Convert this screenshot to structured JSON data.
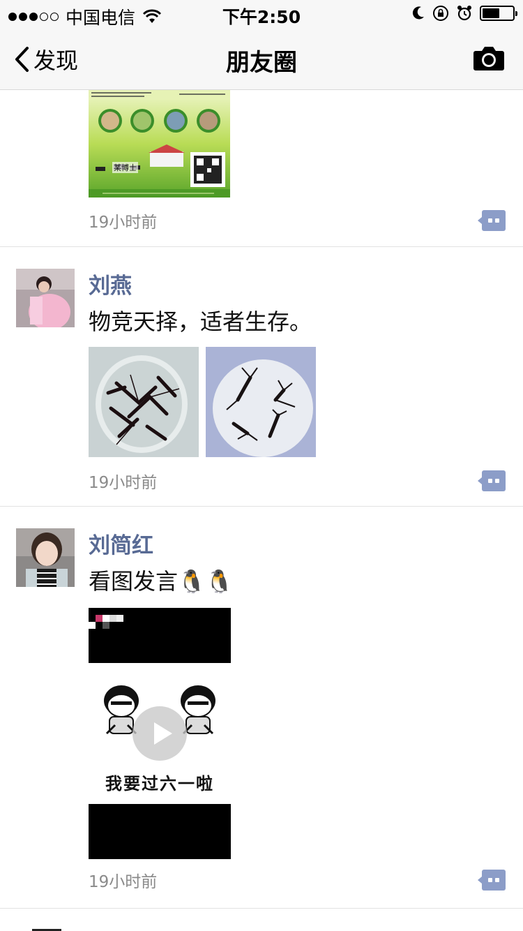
{
  "status_bar": {
    "carrier": "中国电信",
    "time": "下午2:50"
  },
  "nav": {
    "back_label": "发现",
    "title": "朋友圈"
  },
  "posts": [
    {
      "time": "19小时前",
      "image_caption": "某博士"
    },
    {
      "name": "刘燕",
      "text": "物竞天择，适者生存。",
      "time": "19小时前"
    },
    {
      "name": "刘简红",
      "text": "看图发言🐧🐧",
      "time": "19小时前",
      "video_caption": "我要过六一啦"
    }
  ],
  "colors": {
    "name": "#586a94",
    "comment_button": "#8c9dc8"
  }
}
